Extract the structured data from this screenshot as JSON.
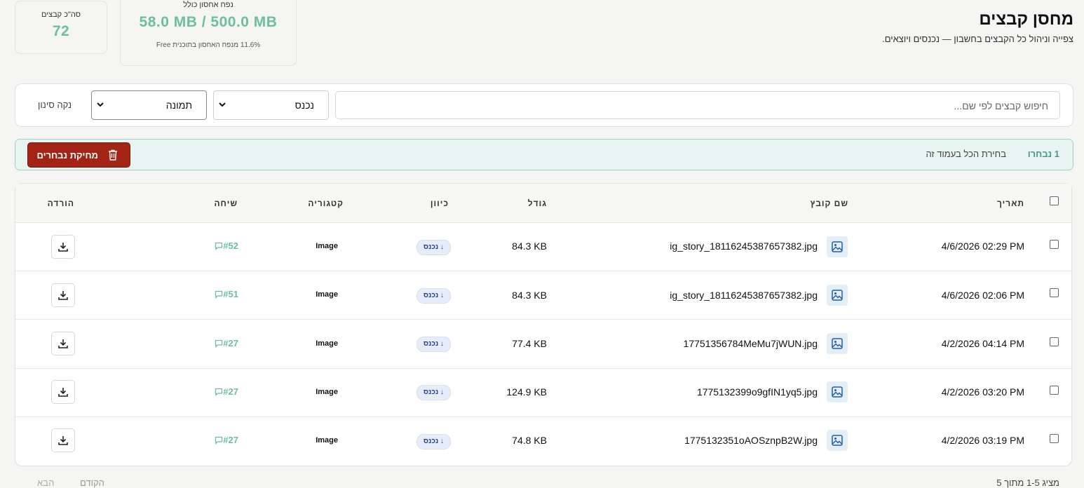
{
  "header": {
    "title": "מחסן קבצים",
    "subtitle": "צפייה וניהול כל הקבצים בחשבון — נכנסים ויוצאים."
  },
  "stats": {
    "storage": {
      "label": "נפח אחסון כולל",
      "value": "58.0 MB / 500.0 MB",
      "note": "11.6% מנפח האחסון בתוכנית Free",
      "percent": 11.6
    },
    "files": {
      "label": "סה\"כ קבצים",
      "value": "72"
    }
  },
  "filters": {
    "search_placeholder": "חיפוש קבצים לפי שם...",
    "direction_value": "נכנס",
    "category_value": "תמונה",
    "clear_label": "נקה סינון"
  },
  "selection": {
    "count_label": "1 נבחרו",
    "select_all_label": "בחירת הכל בעמוד זה",
    "delete_label": "מחיקת נבחרים"
  },
  "table": {
    "columns": {
      "date": "תאריך",
      "filename": "שם קובץ",
      "size": "גודל",
      "direction": "כיוון",
      "category": "קטגוריה",
      "chat": "שיחה",
      "download": "הורדה"
    },
    "rows": [
      {
        "date": "4/6/2026 02:29 PM",
        "filename": "ig_story_18116245387657382.jpg",
        "size": "84.3 KB",
        "direction": "נכנס ↓",
        "category": "Image",
        "chat": "#52"
      },
      {
        "date": "4/6/2026 02:06 PM",
        "filename": "ig_story_18116245387657382.jpg",
        "size": "84.3 KB",
        "direction": "נכנס ↓",
        "category": "Image",
        "chat": "#51"
      },
      {
        "date": "4/2/2026 04:14 PM",
        "filename": "17751356784MeMu7jWUN.jpg",
        "size": "77.4 KB",
        "direction": "נכנס ↓",
        "category": "Image",
        "chat": "#27"
      },
      {
        "date": "4/2/2026 03:20 PM",
        "filename": "1775132399o9gfIN1yq5.jpg",
        "size": "124.9 KB",
        "direction": "נכנס ↓",
        "category": "Image",
        "chat": "#27"
      },
      {
        "date": "4/2/2026 03:19 PM",
        "filename": "1775132351oAOSznpB2W.jpg",
        "size": "74.8 KB",
        "direction": "נכנס ↓",
        "category": "Image",
        "chat": "#27"
      }
    ]
  },
  "footer": {
    "count_text": "מציג 1-5 מתוך 5",
    "prev_label": "הקודם",
    "next_label": "הבא"
  },
  "colors": {
    "accent": "#6bbf9e",
    "danger": "#a32415",
    "badge_text": "#1f3f96"
  }
}
